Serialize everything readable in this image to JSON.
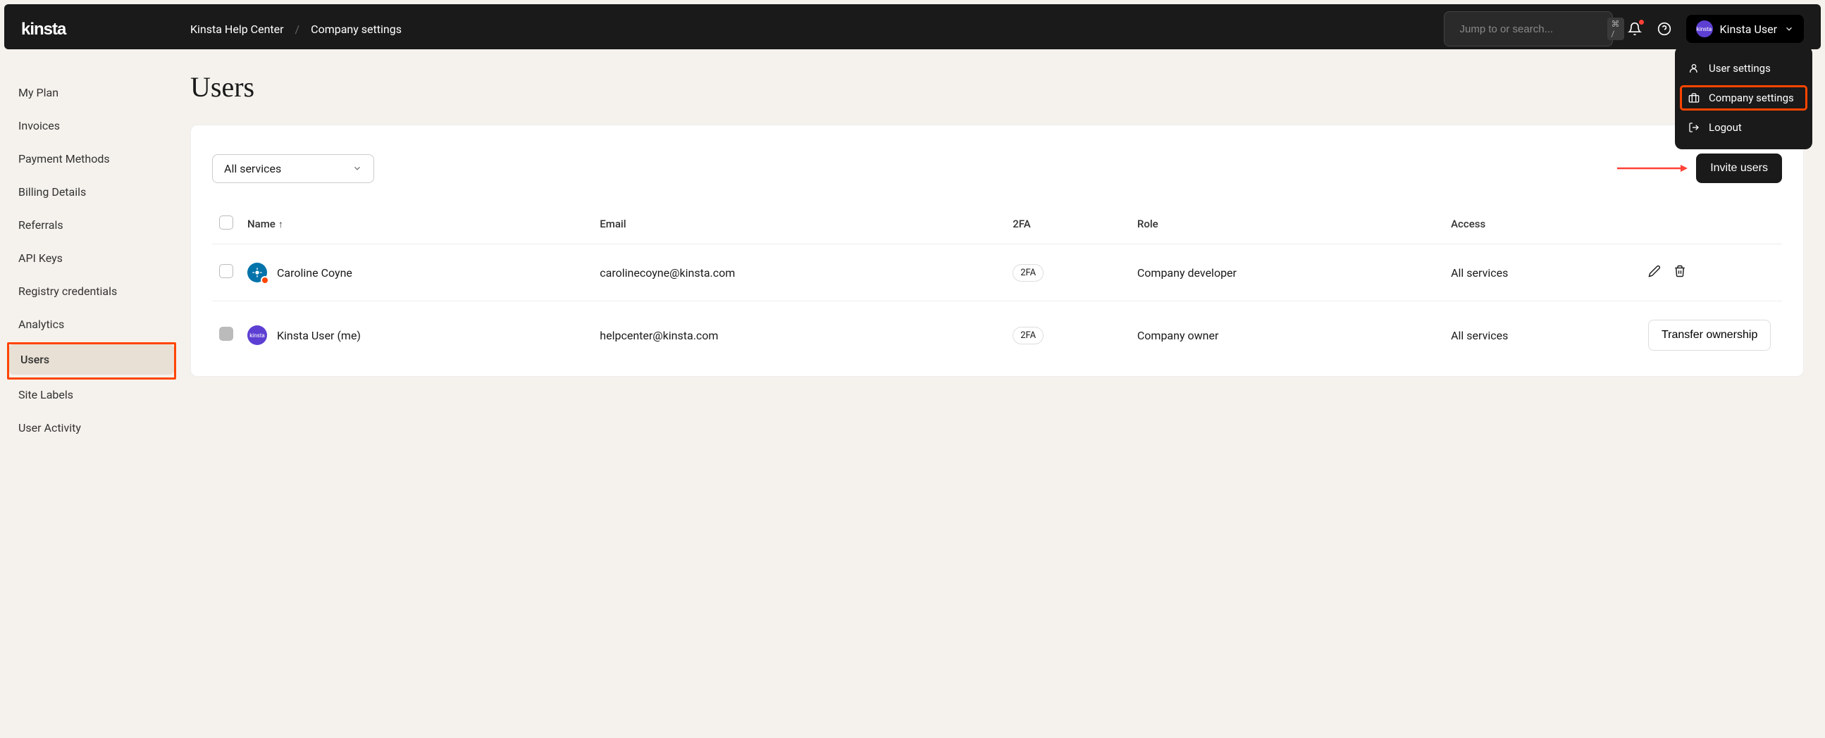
{
  "logo": "kinsta",
  "breadcrumb": {
    "item1": "Kinsta Help Center",
    "item2": "Company settings"
  },
  "search": {
    "placeholder": "Jump to or search...",
    "shortcut": "⌘ /"
  },
  "user": {
    "name": "Kinsta User",
    "avatar_label": "kinsta"
  },
  "dropdown": {
    "user_settings": "User settings",
    "company_settings": "Company settings",
    "logout": "Logout"
  },
  "sidebar": {
    "items": [
      "My Plan",
      "Invoices",
      "Payment Methods",
      "Billing Details",
      "Referrals",
      "API Keys",
      "Registry credentials",
      "Analytics",
      "Users",
      "Site Labels",
      "User Activity"
    ]
  },
  "page_title": "Users",
  "filter": {
    "selected": "All services"
  },
  "invite_button": "Invite users",
  "table": {
    "headers": {
      "name": "Name",
      "email": "Email",
      "twofa": "2FA",
      "role": "Role",
      "access": "Access"
    },
    "rows": [
      {
        "name": "Caroline Coyne",
        "email": "carolinecoyne@kinsta.com",
        "twofa": "2FA",
        "role": "Company developer",
        "access": "All services",
        "avatar_color": "blue",
        "has_badge": true
      },
      {
        "name": "Kinsta User (me)",
        "email": "helpcenter@kinsta.com",
        "twofa": "2FA",
        "role": "Company owner",
        "access": "All services",
        "avatar_color": "purple",
        "avatar_text": "kinsta",
        "action_button": "Transfer ownership"
      }
    ]
  }
}
